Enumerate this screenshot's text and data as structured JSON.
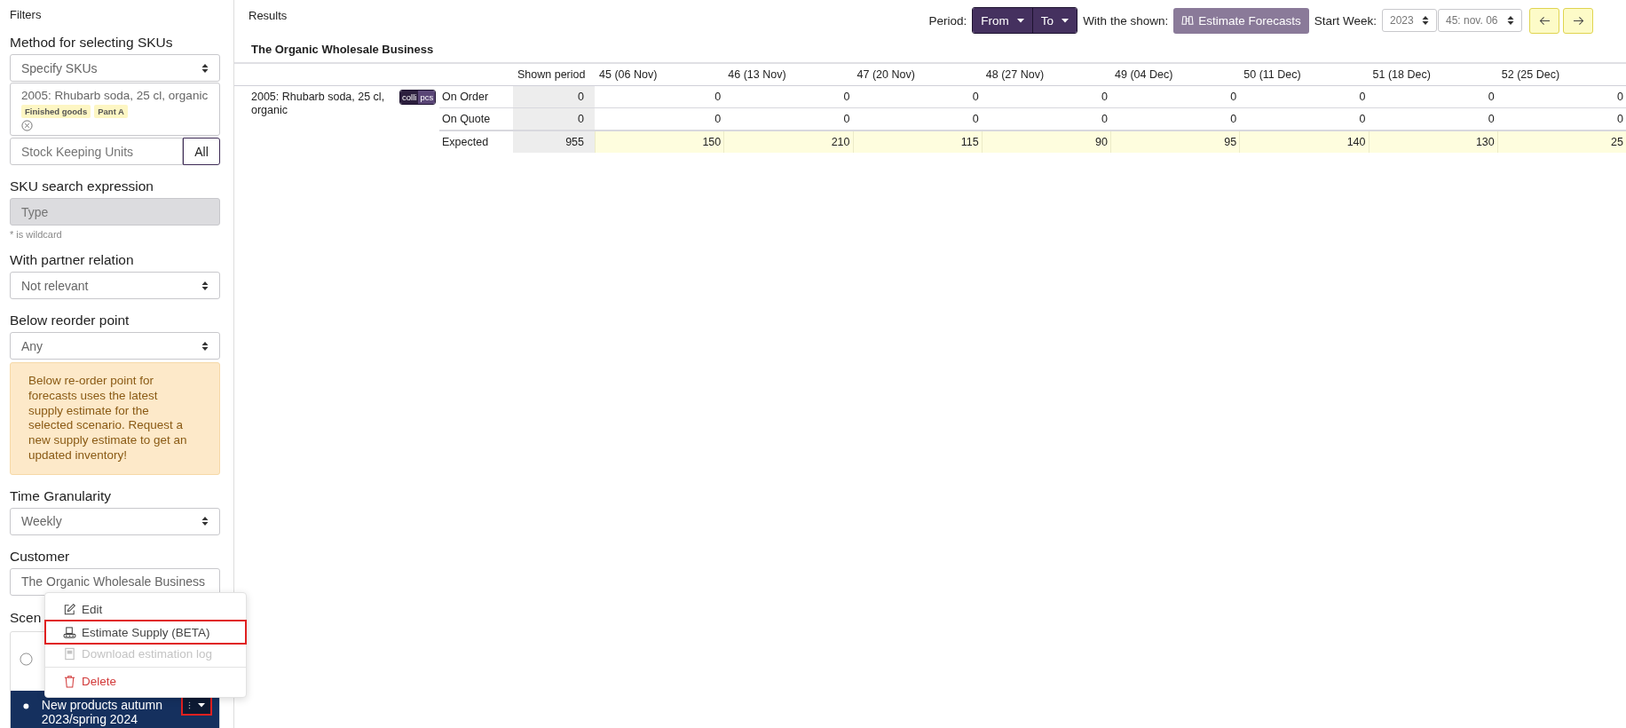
{
  "sidebar": {
    "title": "Filters",
    "sku_method": {
      "label": "Method for selecting SKUs",
      "value": "Specify SKUs"
    },
    "selected_skus": [
      {
        "name": "2005: Rhubarb soda, 25 cl, organic",
        "tags": [
          "Finished goods",
          "Pant A"
        ]
      }
    ],
    "sku_input": {
      "placeholder": "Stock Keeping Units",
      "button": "All"
    },
    "sku_search": {
      "label": "SKU search expression",
      "placeholder": "Type",
      "disabled": true,
      "hint": "* is wildcard"
    },
    "partner_relation": {
      "label": "With partner relation",
      "value": "Not relevant"
    },
    "reorder_point": {
      "label": "Below reorder point",
      "value": "Any"
    },
    "warning": "Below re-order point for forecasts uses the latest supply estimate for the selected scenario. Request a new supply estimate to get an updated inventory!",
    "granularity": {
      "label": "Time Granularity",
      "value": "Weekly"
    },
    "customer": {
      "label": "Customer",
      "value": "The Organic Wholesale Business"
    },
    "scenarios": {
      "label": "Scen",
      "items": [
        {
          "selected": false
        },
        {
          "name": "New products autumn 2023/spring 2024",
          "selected": true,
          "actions_highlighted": true
        }
      ]
    }
  },
  "context_menu": {
    "items": [
      {
        "label": "Edit",
        "kind": "edit",
        "disabled": false,
        "highlighted": false
      },
      {
        "label": "Estimate Supply (BETA)",
        "kind": "supply",
        "disabled": false,
        "highlighted": true
      },
      {
        "label": "Download estimation log",
        "kind": "download",
        "disabled": true,
        "highlighted": false
      },
      {
        "label": "Delete",
        "kind": "delete",
        "disabled": false,
        "highlighted": false
      }
    ]
  },
  "results": {
    "title": "Results",
    "toolbar": {
      "period_label": "Period:",
      "from": "From",
      "to": "To",
      "shown_label": "With the shown:",
      "estimate_button": "Estimate Forecasts",
      "start_week_label": "Start Week:",
      "year": "2023",
      "week": "45: nov. 06"
    },
    "customer": "The Organic Wholesale Business",
    "table": {
      "columns": [
        "Shown period",
        "45 (06 Nov)",
        "46 (13 Nov)",
        "47 (20 Nov)",
        "48 (27 Nov)",
        "49 (04 Dec)",
        "50 (11 Dec)",
        "51 (18 Dec)",
        "52 (25 Dec)"
      ],
      "product": "2005: Rhubarb soda, 25 cl, organic",
      "units": [
        {
          "label": "colli",
          "selected": true
        },
        {
          "label": "pcs",
          "selected": false
        }
      ],
      "rows": [
        {
          "label": "On Order",
          "kind": "plain",
          "values": [
            "0",
            "0",
            "0",
            "0",
            "0",
            "0",
            "0",
            "0",
            "0"
          ]
        },
        {
          "label": "On Quote",
          "kind": "plain",
          "values": [
            "0",
            "0",
            "0",
            "0",
            "0",
            "0",
            "0",
            "0",
            "0"
          ]
        },
        {
          "label": "Expected",
          "kind": "expected",
          "values": [
            "955",
            "150",
            "210",
            "115",
            "90",
            "95",
            "140",
            "130",
            "25"
          ]
        }
      ]
    }
  }
}
